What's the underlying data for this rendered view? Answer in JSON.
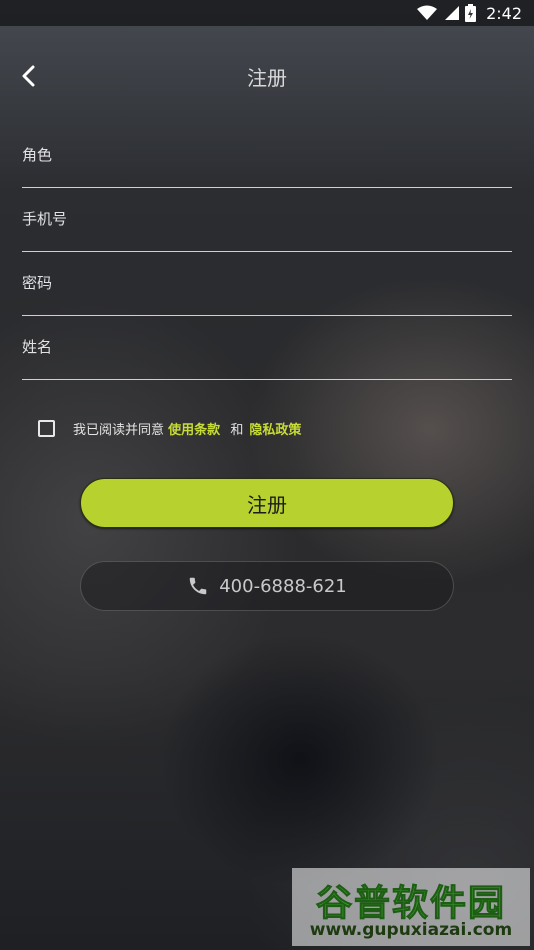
{
  "status_bar": {
    "time": "2:42",
    "icons": [
      "wifi-icon",
      "signal-icon",
      "battery-icon"
    ]
  },
  "header": {
    "title": "注册",
    "back_icon": "chevron-left-icon"
  },
  "form": {
    "fields": [
      {
        "placeholder": "角色",
        "value": ""
      },
      {
        "placeholder": "手机号",
        "value": ""
      },
      {
        "placeholder": "密码",
        "value": ""
      },
      {
        "placeholder": "姓名",
        "value": ""
      }
    ]
  },
  "agreement": {
    "checked": false,
    "prefix": "我已阅读并同意",
    "terms_link": "使用条款",
    "and": "和",
    "privacy_link": "隐私政策"
  },
  "register_button": {
    "label": "注册"
  },
  "phone_button": {
    "icon": "phone-icon",
    "number": "400-6888-621"
  },
  "watermark": {
    "name": "谷普软件园",
    "url": "www.gupuxiazai.com"
  },
  "colors": {
    "accent": "#b7d12f",
    "link": "#c7dc34",
    "background": "#2a2a2c"
  }
}
